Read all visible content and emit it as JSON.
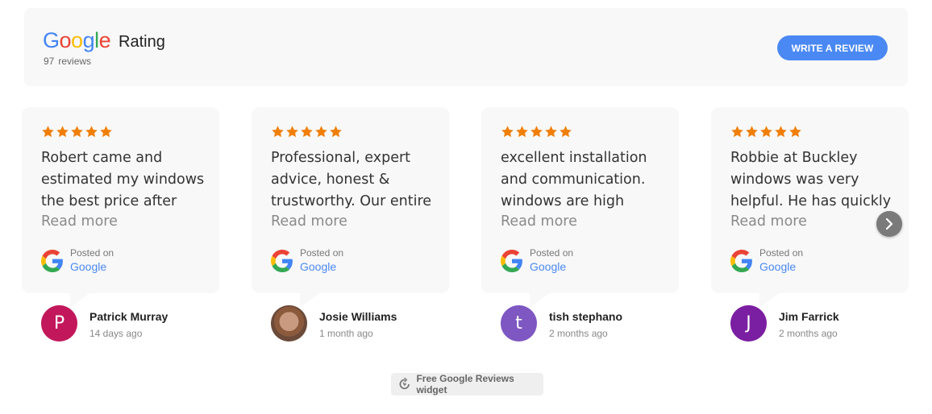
{
  "header": {
    "logo_letters": [
      "G",
      "o",
      "o",
      "g",
      "l",
      "e"
    ],
    "rating_label": "Rating",
    "review_count": "97",
    "review_count_label": "reviews",
    "write_button": "WRITE A REVIEW"
  },
  "colors": {
    "accent": "#4a89f3",
    "star": "#f07f0a",
    "card_bg": "#f8f8f8"
  },
  "cards": [
    {
      "stars": 5,
      "text": "Robert came and estimated my windows the best price after",
      "read_more": "Read more",
      "posted_on": "Posted on",
      "source": "Google",
      "author": "Patrick Murray",
      "time": "14 days ago",
      "avatar_letter": "P",
      "avatar_color": "#c2185b"
    },
    {
      "stars": 5,
      "text": "Professional, expert advice, honest & trustworthy. Our entire",
      "read_more": "Read more",
      "posted_on": "Posted on",
      "source": "Google",
      "author": "Josie Williams",
      "time": "1 month ago",
      "avatar_letter": "",
      "avatar_color": ""
    },
    {
      "stars": 5,
      "text": "excellent installation and communication. windows are high",
      "read_more": "Read more",
      "posted_on": "Posted on",
      "source": "Google",
      "author": "tish stephano",
      "time": "2 months ago",
      "avatar_letter": "t",
      "avatar_color": "#7e57c2"
    },
    {
      "stars": 5,
      "text": "Robbie at Buckley windows was very helpful. He has quickly",
      "read_more": "Read more",
      "posted_on": "Posted on",
      "source": "Google",
      "author": "Jim Farrick",
      "time": "2 months ago",
      "avatar_letter": "J",
      "avatar_color": "#7b1fa2"
    }
  ],
  "footer": {
    "widget_label": "Free Google Reviews widget"
  },
  "icons": {
    "next": "chevron-right-icon",
    "google": "google-g-icon",
    "star": "star-icon",
    "widget": "refresh-icon"
  }
}
